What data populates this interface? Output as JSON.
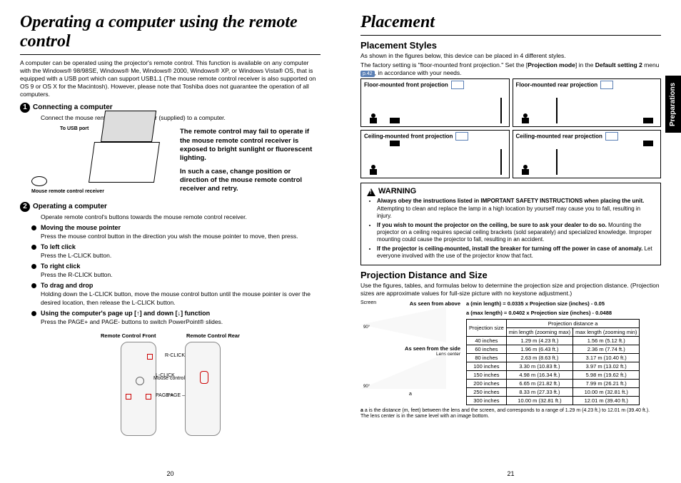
{
  "left": {
    "title": "Operating a computer using the remote control",
    "intro": "A computer can be operated using the projector's remote control. This function is available on any computer with the Windows® 98/98SE, Windows® Me, Windows® 2000, Windows® XP, or Windows Vista® OS, that is equipped with a USB port which can support USB1.1 (The mouse remote control receiver is also supported on OS 9 or OS X for the Macintosh). However, please note that Toshiba does not guarantee the operation of all computers.",
    "s1_title": "Connecting a computer",
    "s1_text": "Connect the mouse remote control receiver (supplied) to a computer.",
    "usb_label": "To USB port",
    "receiver_label": "Mouse remote control receiver",
    "note1": "The remote control may fail to operate if the mouse remote control receiver is exposed to bright sunlight or fluorescent lighting.",
    "note2": "In such a case, change position or direction of the mouse remote control receiver and retry.",
    "s2_title": "Operating a computer",
    "s2_text": "Operate remote control's buttons towards the mouse remote control receiver.",
    "b1t": "Moving the mouse pointer",
    "b1d": "Press the mouse control button in the direction you wish the mouse pointer to move, then press.",
    "b2t": "To left click",
    "b2d": "Press the L-CLICK button.",
    "b3t": "To right click",
    "b3d": "Press the R-CLICK button.",
    "b4t": "To drag and drop",
    "b4d": "Holding down the L-CLICK button, move the mouse control button until the mouse pointer is over the desired location, then release the L-CLICK button.",
    "b5t": "Using the computer's page up [↑] and down [↓] function",
    "b5d": "Press the PAGE+ and PAGE- buttons to switch PowerPoint® slides.",
    "rf": "Remote Control Front",
    "rr": "Remote Control Rear",
    "c_rclick": "R-CLICK",
    "c_lclick": "L-CLICK",
    "c_mouse": "Mouse control",
    "c_pagem": "PAGE –",
    "c_pagep": "PAGE +",
    "page": "20"
  },
  "right": {
    "title": "Placement",
    "ps_title": "Placement Styles",
    "ps_text1": "As shown in the figures below, this device can be placed in 4 different styles.",
    "ps_text2a": "The factory setting is \"floor-mounted front projection.\" Set the [",
    "ps_text2b": "Projection mode",
    "ps_text2c": "] in the ",
    "ps_text2d": "Default setting 2",
    "ps_text2e": " menu ",
    "ps_ref": "p.42",
    "ps_text2f": ", in accordance with your needs.",
    "p1": "Floor-mounted front projection",
    "p2": "Floor-mounted rear projection",
    "p3": "Ceiling-mounted front projection",
    "p4": "Ceiling-mounted rear projection",
    "warn": "WARNING",
    "w1a": "Always obey the instructions listed in IMPORTANT SAFETY INSTRUCTIONS when placing the unit.",
    "w1b": " Attempting to clean and replace the lamp in a high location by yourself may cause you to fall, resulting in injury.",
    "w2a": "If you wish to mount the projector on the ceiling, be sure to ask your dealer to do so.",
    "w2b": " Mounting the projector on a ceiling requires special ceiling brackets (sold separately) and specialized knowledge. Improper mounting could cause the projector to fall, resulting in an accident.",
    "w3a": "If the projector is ceiling-mounted, install the breaker for turning off the power in case of anomaly.",
    "w3b": " Let everyone involved with the use of the projector know that fact.",
    "pd_title": "Projection Distance and Size",
    "pd_text": "Use the figures, tables, and formulas below to determine the projection size and projection distance. (Projection sizes are approximate values for full-size picture with no keystone adjustment.)",
    "d_screen": "Screen",
    "d_above": "As seen from above",
    "d_side": "As seen from the side",
    "d_lens": "Lens center",
    "d_a": "a",
    "d_90": "90°",
    "f1": "a (min length) = 0.0335 x Projection size (inches) - 0.05",
    "f2": "a (max length) = 0.0402 x Projection size (inches) - 0.0488",
    "th_size": "Projection size",
    "th_dist": "Projection distance a",
    "th_min": "min length (zooming max)",
    "th_max": "max length (zooming min)",
    "rows": [
      {
        "s": "40 inches",
        "min": "1.29 m (4.23 ft.)",
        "max": "1.56 m (5.12 ft.)"
      },
      {
        "s": "60 inches",
        "min": "1.96 m (6.43 ft.)",
        "max": "2.36 m (7.74 ft.)"
      },
      {
        "s": "80 inches",
        "min": "2.63 m (8.63 ft.)",
        "max": "3.17 m (10.40 ft.)"
      },
      {
        "s": "100 inches",
        "min": "3.30 m (10.83 ft.)",
        "max": "3.97 m (13.02 ft.)"
      },
      {
        "s": "150 inches",
        "min": "4.98 m (16.34 ft.)",
        "max": "5.98 m (19.62 ft.)"
      },
      {
        "s": "200 inches",
        "min": "6.65 m (21.82 ft.)",
        "max": "7.99 m (26.21 ft.)"
      },
      {
        "s": "250 inches",
        "min": "8.33 m (27.33 ft.)",
        "max": "10.00 m (32.81 ft.)"
      },
      {
        "s": "300 inches",
        "min": "10.00 m (32.81 ft.)",
        "max": "12.01 m (39.40 ft.)"
      }
    ],
    "fn1": "a is the distance (m, feet) between the lens and the screen, and corresponds to a range of 1.29 m (4.23 ft.) to 12.01 m (39.40 ft.).",
    "fn2": "The lens center is in the same level with an image bottom.",
    "tab": "Preparations",
    "page": "21"
  }
}
